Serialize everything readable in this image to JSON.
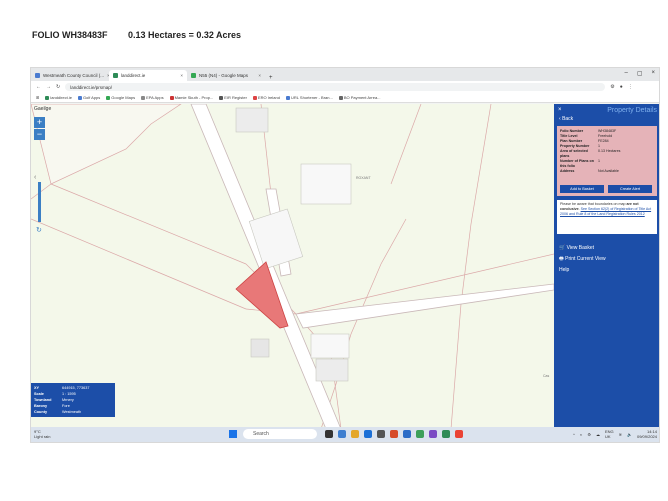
{
  "header": {
    "folio": "FOLIO WH38483F",
    "area": "0.13 Hectares  =  0.32 Acres"
  },
  "browser": {
    "tabs": [
      {
        "label": "Westmeath County Council (...",
        "active": false
      },
      {
        "label": "landdirect.ie",
        "active": true
      },
      {
        "label": "N55 (N4) - Google Maps",
        "active": false
      }
    ],
    "url": "landdirect.ie/prsmap/",
    "bookmarks": [
      "landdirect.ie",
      "Golf Apps",
      "Google Maps",
      "EPA Apps",
      "Mamie Skuth - Prop...",
      "EIR Register",
      "ERO Ireland",
      "URL Shortener - Bran...",
      "BO Payment Arrea..."
    ]
  },
  "map": {
    "lang_link": "Gaeilge",
    "zoom_in": "+",
    "zoom_out": "−",
    "info": [
      {
        "k": "XY",
        "v": "644915, 773637"
      },
      {
        "k": "Scale",
        "v": "1 : 1595"
      },
      {
        "k": "Townland",
        "v": "Mrnery"
      },
      {
        "k": "Barony",
        "v": "Fore"
      },
      {
        "k": "County",
        "v": "Westmeath"
      }
    ],
    "labels": [
      "ROXANT",
      "Cas"
    ]
  },
  "panel": {
    "title": "Property Details",
    "back": "Back",
    "details": [
      {
        "k": "Folio Number",
        "v": "WH38483F"
      },
      {
        "k": "Title Level",
        "v": "Freehold"
      },
      {
        "k": "Plan Number",
        "v": "FE284"
      },
      {
        "k": "Property Number",
        "v": "1"
      },
      {
        "k": "Area of selected plans",
        "v": "0.13 Hectares"
      },
      {
        "k": "Number of Plans on this folio",
        "v": "1"
      },
      {
        "k": "Address",
        "v": "Not Available"
      }
    ],
    "add_button": "Add to Basket",
    "create_button": "Create Alert",
    "note_prefix": "Please be aware that boundaries on map",
    "note_middle": "are not conclusive",
    "note_links": "See Section 62(2) of Registration of Title Act 2006 and Rule 8 of the Land Registration Rules 2012",
    "links": [
      "View Basket",
      "Print Current View",
      "Help"
    ]
  },
  "taskbar": {
    "weather_temp": "9°C",
    "weather_desc": "Light rain",
    "search": "Search",
    "lang": "ENG",
    "lang2": "UK",
    "time": "14:14",
    "date": "09/09/2024"
  },
  "colors": {
    "panel": "#1c4ea8",
    "parcel": "#e87878",
    "card": "#e5b3b8"
  }
}
